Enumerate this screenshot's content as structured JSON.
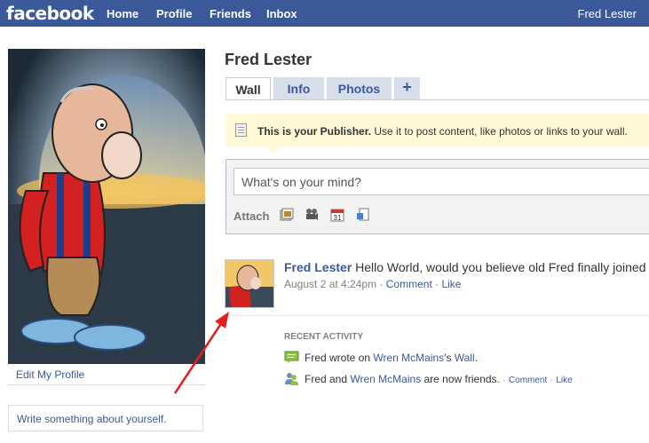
{
  "topbar": {
    "logo": "facebook",
    "nav": [
      "Home",
      "Profile",
      "Friends",
      "Inbox"
    ],
    "user": "Fred Lester"
  },
  "sidebar": {
    "edit_profile": "Edit My Profile",
    "about_placeholder": "Write something about yourself."
  },
  "profile": {
    "name": "Fred Lester",
    "tabs": [
      {
        "label": "Wall",
        "active": true
      },
      {
        "label": "Info",
        "active": false
      },
      {
        "label": "Photos",
        "active": false
      },
      {
        "label": "+",
        "active": false
      }
    ]
  },
  "publisher": {
    "tip_bold": "This is your Publisher.",
    "tip_text": " Use it to post content, like photos or links to your wall.",
    "placeholder": "What's on your mind?",
    "attach_label": "Attach",
    "attach_icons": [
      "photo-icon",
      "video-icon",
      "event-icon",
      "link-icon"
    ]
  },
  "post": {
    "author": "Fred Lester",
    "text": " Hello World, would you believe old Fred finally joined F",
    "time": "August 2 at 4:24pm",
    "comment": "Comment",
    "like": "Like",
    "sep": "·"
  },
  "recent_activity": {
    "title": "RECENT ACTIVITY",
    "item1": {
      "prefix": "Fred wrote on ",
      "link": "Wren McMains",
      "suffix1": "'s ",
      "link2": "Wall",
      "suffix2": "."
    },
    "item2": {
      "prefix": "Fred and ",
      "link": "Wren McMains",
      "suffix": " are now friends.",
      "comment": "Comment",
      "like": "Like",
      "sep": "·"
    }
  },
  "colors": {
    "brand": "#3b5998",
    "tab_bg": "#d8dfea",
    "tip_bg": "#fff9d7",
    "arrow": "#e0201f"
  }
}
